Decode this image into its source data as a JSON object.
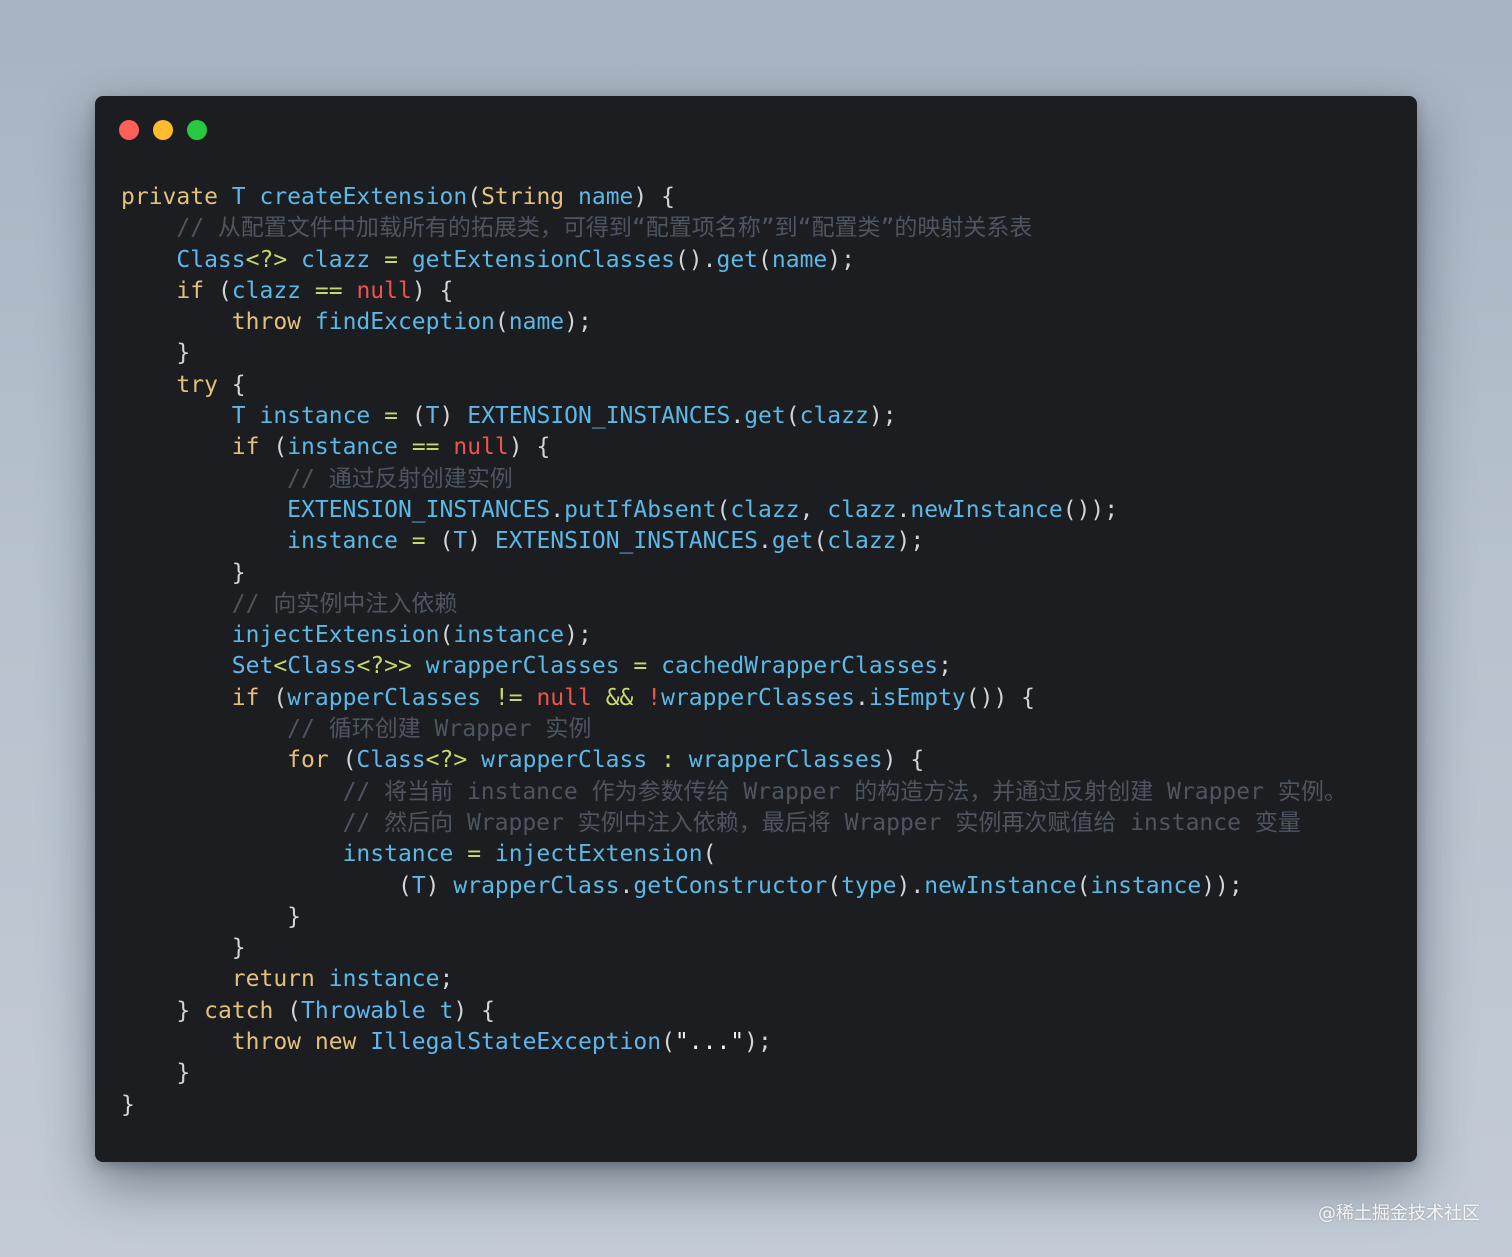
{
  "colors": {
    "keyword": "#e5c07b",
    "type": "#61b6ef",
    "ident": "#5cb8e6",
    "null": "#ef5350",
    "op": "#c8d86a",
    "comment": "#4e5561",
    "punct": "#d4d4d4",
    "string": "#f0f0f0",
    "traffic_red": "#fe5f57",
    "traffic_yellow": "#febc2e",
    "traffic_green": "#28c840"
  },
  "code_lines": [
    [
      [
        "keyword",
        "private "
      ],
      [
        "type",
        "T "
      ],
      [
        "ident",
        "createExtension"
      ],
      [
        "punct",
        "("
      ],
      [
        "keyword",
        "String "
      ],
      [
        "ident",
        "name"
      ],
      [
        "punct",
        ") {"
      ]
    ],
    [
      [
        "plain",
        "    "
      ],
      [
        "comment",
        "// 从配置文件中加载所有的拓展类，可得到“配置项名称”到“配置类”的映射关系表"
      ]
    ],
    [
      [
        "plain",
        "    "
      ],
      [
        "type",
        "Class"
      ],
      [
        "op",
        "<?> "
      ],
      [
        "ident",
        "clazz "
      ],
      [
        "op",
        "= "
      ],
      [
        "ident",
        "getExtensionClasses"
      ],
      [
        "punct",
        "()."
      ],
      [
        "ident",
        "get"
      ],
      [
        "punct",
        "("
      ],
      [
        "ident",
        "name"
      ],
      [
        "punct",
        ");"
      ]
    ],
    [
      [
        "plain",
        "    "
      ],
      [
        "keyword",
        "if "
      ],
      [
        "punct",
        "("
      ],
      [
        "ident",
        "clazz "
      ],
      [
        "op",
        "== "
      ],
      [
        "null",
        "null"
      ],
      [
        "punct",
        ") {"
      ]
    ],
    [
      [
        "plain",
        "        "
      ],
      [
        "keyword",
        "throw "
      ],
      [
        "ident",
        "findException"
      ],
      [
        "punct",
        "("
      ],
      [
        "ident",
        "name"
      ],
      [
        "punct",
        ");"
      ]
    ],
    [
      [
        "plain",
        "    "
      ],
      [
        "punct",
        "}"
      ]
    ],
    [
      [
        "plain",
        "    "
      ],
      [
        "keyword",
        "try "
      ],
      [
        "punct",
        "{"
      ]
    ],
    [
      [
        "plain",
        "        "
      ],
      [
        "type",
        "T "
      ],
      [
        "ident",
        "instance "
      ],
      [
        "op",
        "= "
      ],
      [
        "punct",
        "("
      ],
      [
        "type",
        "T"
      ],
      [
        "punct",
        ") "
      ],
      [
        "ident",
        "EXTENSION_INSTANCES"
      ],
      [
        "punct",
        "."
      ],
      [
        "ident",
        "get"
      ],
      [
        "punct",
        "("
      ],
      [
        "ident",
        "clazz"
      ],
      [
        "punct",
        ");"
      ]
    ],
    [
      [
        "plain",
        "        "
      ],
      [
        "keyword",
        "if "
      ],
      [
        "punct",
        "("
      ],
      [
        "ident",
        "instance "
      ],
      [
        "op",
        "== "
      ],
      [
        "null",
        "null"
      ],
      [
        "punct",
        ") {"
      ]
    ],
    [
      [
        "plain",
        "            "
      ],
      [
        "comment",
        "// 通过反射创建实例"
      ]
    ],
    [
      [
        "plain",
        "            "
      ],
      [
        "ident",
        "EXTENSION_INSTANCES"
      ],
      [
        "punct",
        "."
      ],
      [
        "ident",
        "putIfAbsent"
      ],
      [
        "punct",
        "("
      ],
      [
        "ident",
        "clazz"
      ],
      [
        "punct",
        ", "
      ],
      [
        "ident",
        "clazz"
      ],
      [
        "punct",
        "."
      ],
      [
        "ident",
        "newInstance"
      ],
      [
        "punct",
        "());"
      ]
    ],
    [
      [
        "plain",
        "            "
      ],
      [
        "ident",
        "instance "
      ],
      [
        "op",
        "= "
      ],
      [
        "punct",
        "("
      ],
      [
        "type",
        "T"
      ],
      [
        "punct",
        ") "
      ],
      [
        "ident",
        "EXTENSION_INSTANCES"
      ],
      [
        "punct",
        "."
      ],
      [
        "ident",
        "get"
      ],
      [
        "punct",
        "("
      ],
      [
        "ident",
        "clazz"
      ],
      [
        "punct",
        ");"
      ]
    ],
    [
      [
        "plain",
        "        "
      ],
      [
        "punct",
        "}"
      ]
    ],
    [
      [
        "plain",
        "        "
      ],
      [
        "comment",
        "// 向实例中注入依赖"
      ]
    ],
    [
      [
        "plain",
        "        "
      ],
      [
        "ident",
        "injectExtension"
      ],
      [
        "punct",
        "("
      ],
      [
        "ident",
        "instance"
      ],
      [
        "punct",
        ");"
      ]
    ],
    [
      [
        "plain",
        "        "
      ],
      [
        "type",
        "Set"
      ],
      [
        "op",
        "<"
      ],
      [
        "type",
        "Class"
      ],
      [
        "op",
        "<?>> "
      ],
      [
        "ident",
        "wrapperClasses "
      ],
      [
        "op",
        "= "
      ],
      [
        "ident",
        "cachedWrapperClasses"
      ],
      [
        "punct",
        ";"
      ]
    ],
    [
      [
        "plain",
        "        "
      ],
      [
        "keyword",
        "if "
      ],
      [
        "punct",
        "("
      ],
      [
        "ident",
        "wrapperClasses "
      ],
      [
        "op",
        "!= "
      ],
      [
        "null",
        "null "
      ],
      [
        "op",
        "&& "
      ],
      [
        "null",
        "!"
      ],
      [
        "ident",
        "wrapperClasses"
      ],
      [
        "punct",
        "."
      ],
      [
        "ident",
        "isEmpty"
      ],
      [
        "punct",
        "()) {"
      ]
    ],
    [
      [
        "plain",
        "            "
      ],
      [
        "comment",
        "// 循环创建 Wrapper 实例"
      ]
    ],
    [
      [
        "plain",
        "            "
      ],
      [
        "keyword",
        "for "
      ],
      [
        "punct",
        "("
      ],
      [
        "type",
        "Class"
      ],
      [
        "op",
        "<?> "
      ],
      [
        "ident",
        "wrapperClass "
      ],
      [
        "op",
        ": "
      ],
      [
        "ident",
        "wrapperClasses"
      ],
      [
        "punct",
        ") {"
      ]
    ],
    [
      [
        "plain",
        "                "
      ],
      [
        "comment",
        "// 将当前 instance 作为参数传给 Wrapper 的构造方法，并通过反射创建 Wrapper 实例。"
      ]
    ],
    [
      [
        "plain",
        "                "
      ],
      [
        "comment",
        "// 然后向 Wrapper 实例中注入依赖，最后将 Wrapper 实例再次赋值给 instance 变量"
      ]
    ],
    [
      [
        "plain",
        "                "
      ],
      [
        "ident",
        "instance "
      ],
      [
        "op",
        "= "
      ],
      [
        "ident",
        "injectExtension"
      ],
      [
        "punct",
        "("
      ]
    ],
    [
      [
        "plain",
        "                    "
      ],
      [
        "punct",
        "("
      ],
      [
        "type",
        "T"
      ],
      [
        "punct",
        ") "
      ],
      [
        "ident",
        "wrapperClass"
      ],
      [
        "punct",
        "."
      ],
      [
        "ident",
        "getConstructor"
      ],
      [
        "punct",
        "("
      ],
      [
        "ident",
        "type"
      ],
      [
        "punct",
        ")."
      ],
      [
        "ident",
        "newInstance"
      ],
      [
        "punct",
        "("
      ],
      [
        "ident",
        "instance"
      ],
      [
        "punct",
        "));"
      ]
    ],
    [
      [
        "plain",
        "            "
      ],
      [
        "punct",
        "}"
      ]
    ],
    [
      [
        "plain",
        "        "
      ],
      [
        "punct",
        "}"
      ]
    ],
    [
      [
        "plain",
        "        "
      ],
      [
        "keyword",
        "return "
      ],
      [
        "ident",
        "instance"
      ],
      [
        "punct",
        ";"
      ]
    ],
    [
      [
        "plain",
        "    "
      ],
      [
        "punct",
        "} "
      ],
      [
        "keyword",
        "catch "
      ],
      [
        "punct",
        "("
      ],
      [
        "type",
        "Throwable "
      ],
      [
        "ident",
        "t"
      ],
      [
        "punct",
        ") {"
      ]
    ],
    [
      [
        "plain",
        "        "
      ],
      [
        "keyword",
        "throw new "
      ],
      [
        "type",
        "IllegalStateException"
      ],
      [
        "punct",
        "("
      ],
      [
        "string",
        "\"...\""
      ],
      [
        "punct",
        ");"
      ]
    ],
    [
      [
        "plain",
        "    "
      ],
      [
        "punct",
        "}"
      ]
    ],
    [
      [
        "punct",
        "}"
      ]
    ]
  ],
  "watermark": "@稀土掘金技术社区"
}
